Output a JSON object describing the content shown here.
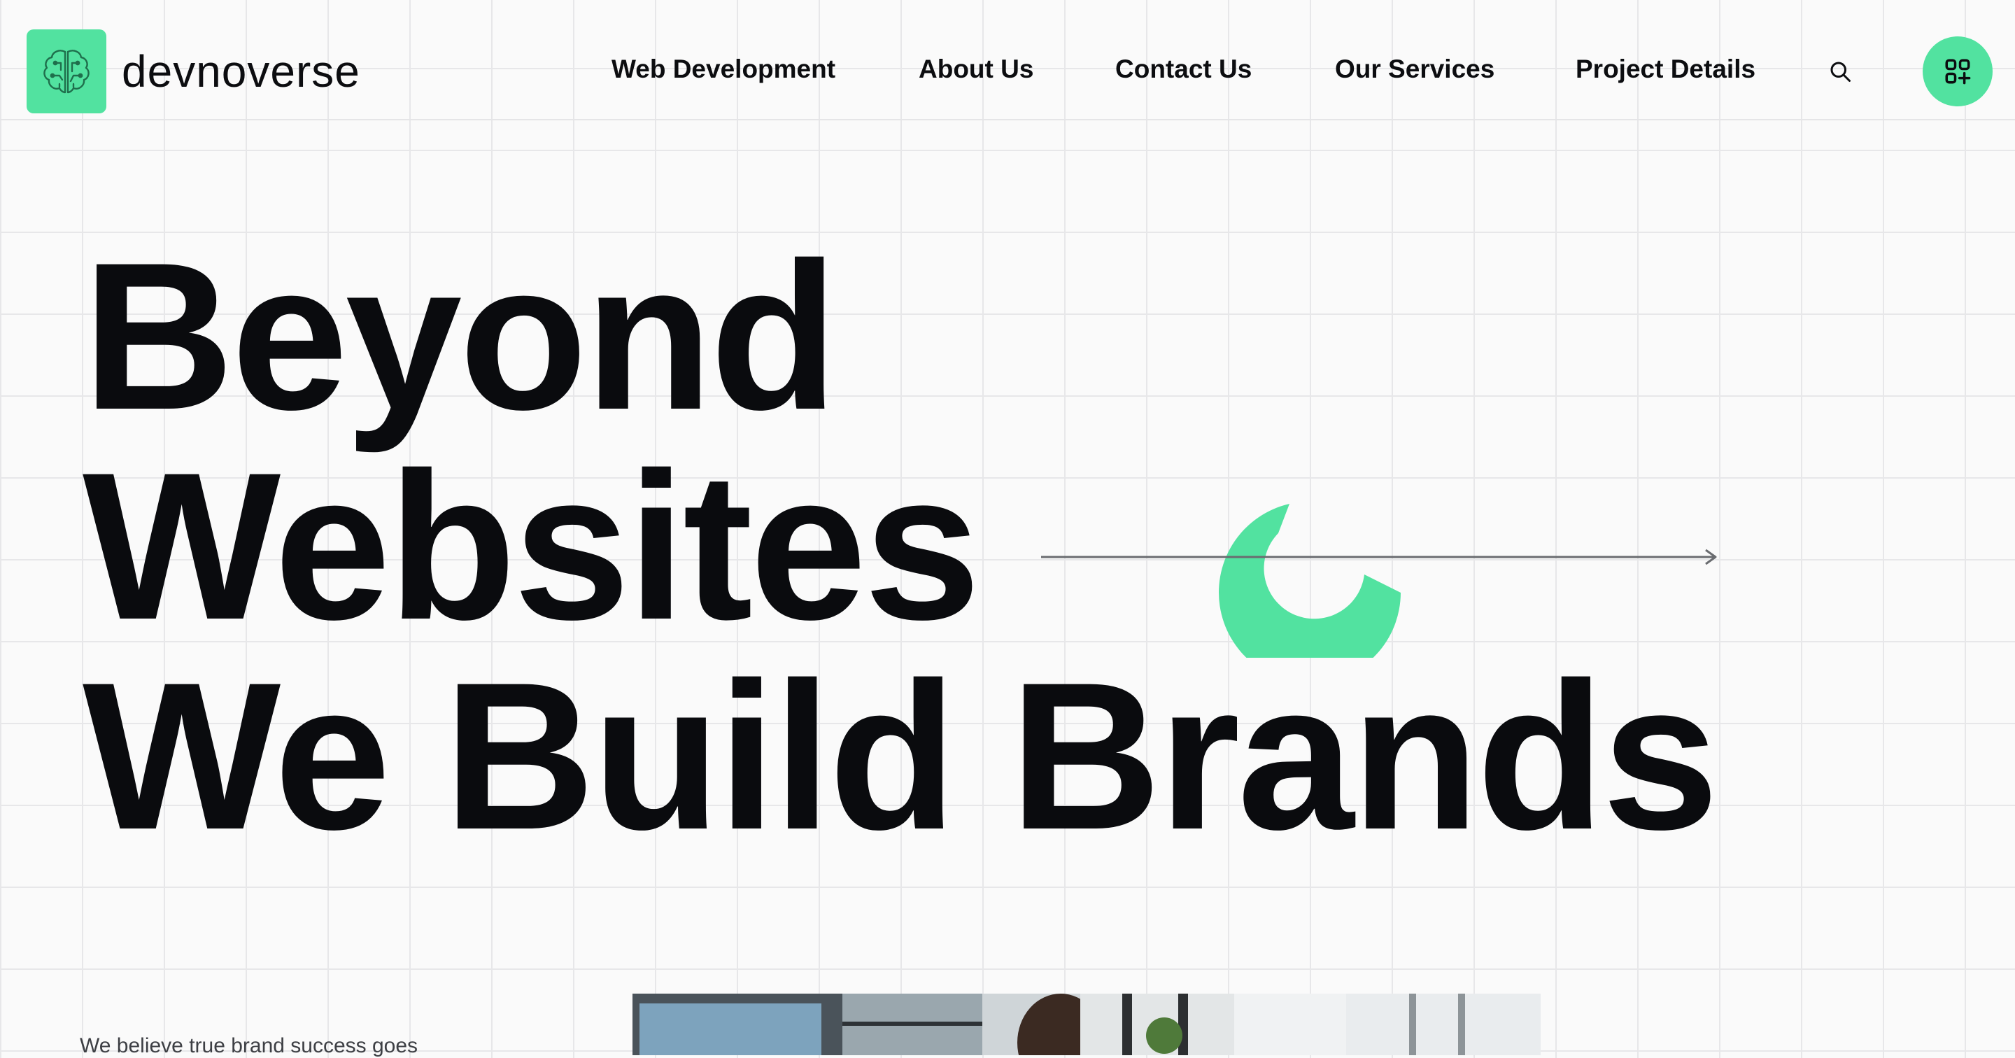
{
  "brand": {
    "name": "devnoverse",
    "logo_icon": "brain-circuit-icon",
    "accent_color": "#52e2a0"
  },
  "nav": {
    "items": [
      {
        "label": "Web Development"
      },
      {
        "label": "About Us"
      },
      {
        "label": "Contact Us"
      },
      {
        "label": "Our Services"
      },
      {
        "label": "Project Details"
      }
    ],
    "search_icon": "search-icon",
    "apps_icon": "grid-plus-icon"
  },
  "hero": {
    "lines": [
      "Beyond",
      "Websites",
      "We Build Brands"
    ]
  },
  "intro": {
    "text": "We believe true brand success goes"
  },
  "colors": {
    "background": "#fafafa",
    "grid": "#e7e7e9",
    "text": "#0a0b0e",
    "accent": "#52e2a0"
  }
}
